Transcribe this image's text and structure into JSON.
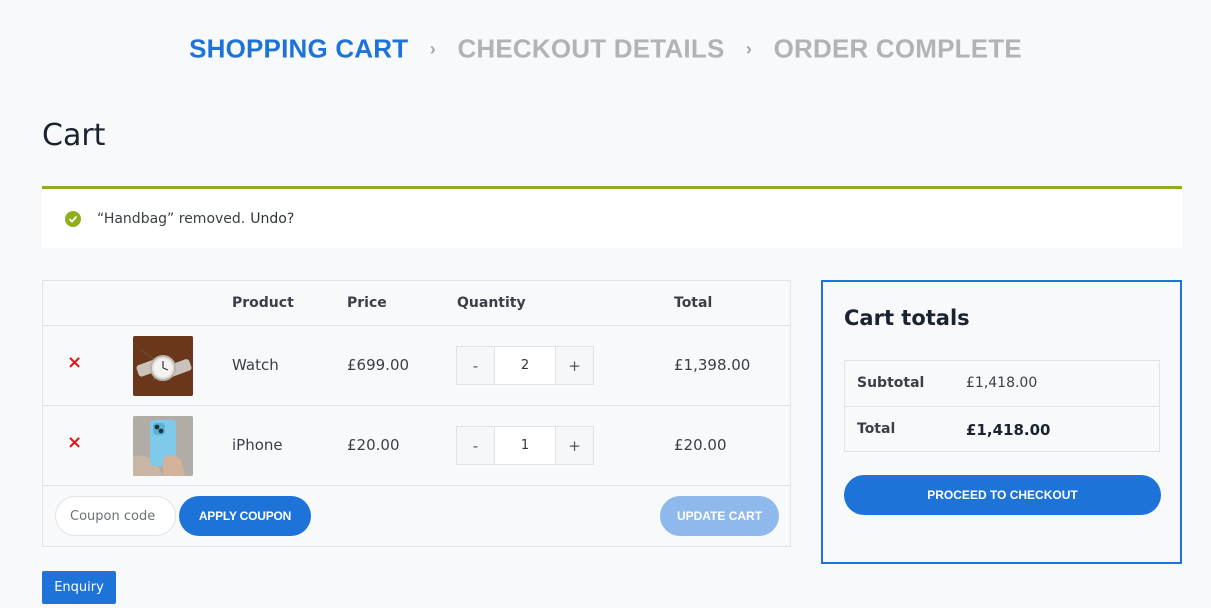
{
  "steps": {
    "step1": "SHOPPING CART",
    "step2": "CHECKOUT DETAILS",
    "step3": "ORDER COMPLETE",
    "separator": "›"
  },
  "page_title": "Cart",
  "notice": {
    "message": "“Handbag” removed.",
    "undo_label": "Undo?"
  },
  "table": {
    "headers": {
      "product": "Product",
      "price": "Price",
      "quantity": "Quantity",
      "total": "Total"
    },
    "rows": [
      {
        "remove": "×",
        "name": "Watch",
        "price": "£699.00",
        "qty": "2",
        "total": "£1,398.00"
      },
      {
        "remove": "×",
        "name": "iPhone",
        "price": "£20.00",
        "qty": "1",
        "total": "£20.00"
      }
    ],
    "minus_label": "-",
    "plus_label": "+"
  },
  "coupon": {
    "placeholder": "Coupon code",
    "apply_label": "APPLY COUPON",
    "update_label": "UPDATE CART"
  },
  "totals": {
    "title": "Cart totals",
    "subtotal_label": "Subtotal",
    "subtotal_value": "£1,418.00",
    "total_label": "Total",
    "total_value": "£1,418.00",
    "checkout_label": "PROCEED TO CHECKOUT"
  },
  "enquiry_label": "Enquiry",
  "colors": {
    "accent": "#1e73d8",
    "success": "#8fae1b",
    "remove": "#e0161b",
    "inactive_step": "#b3b3b3"
  }
}
